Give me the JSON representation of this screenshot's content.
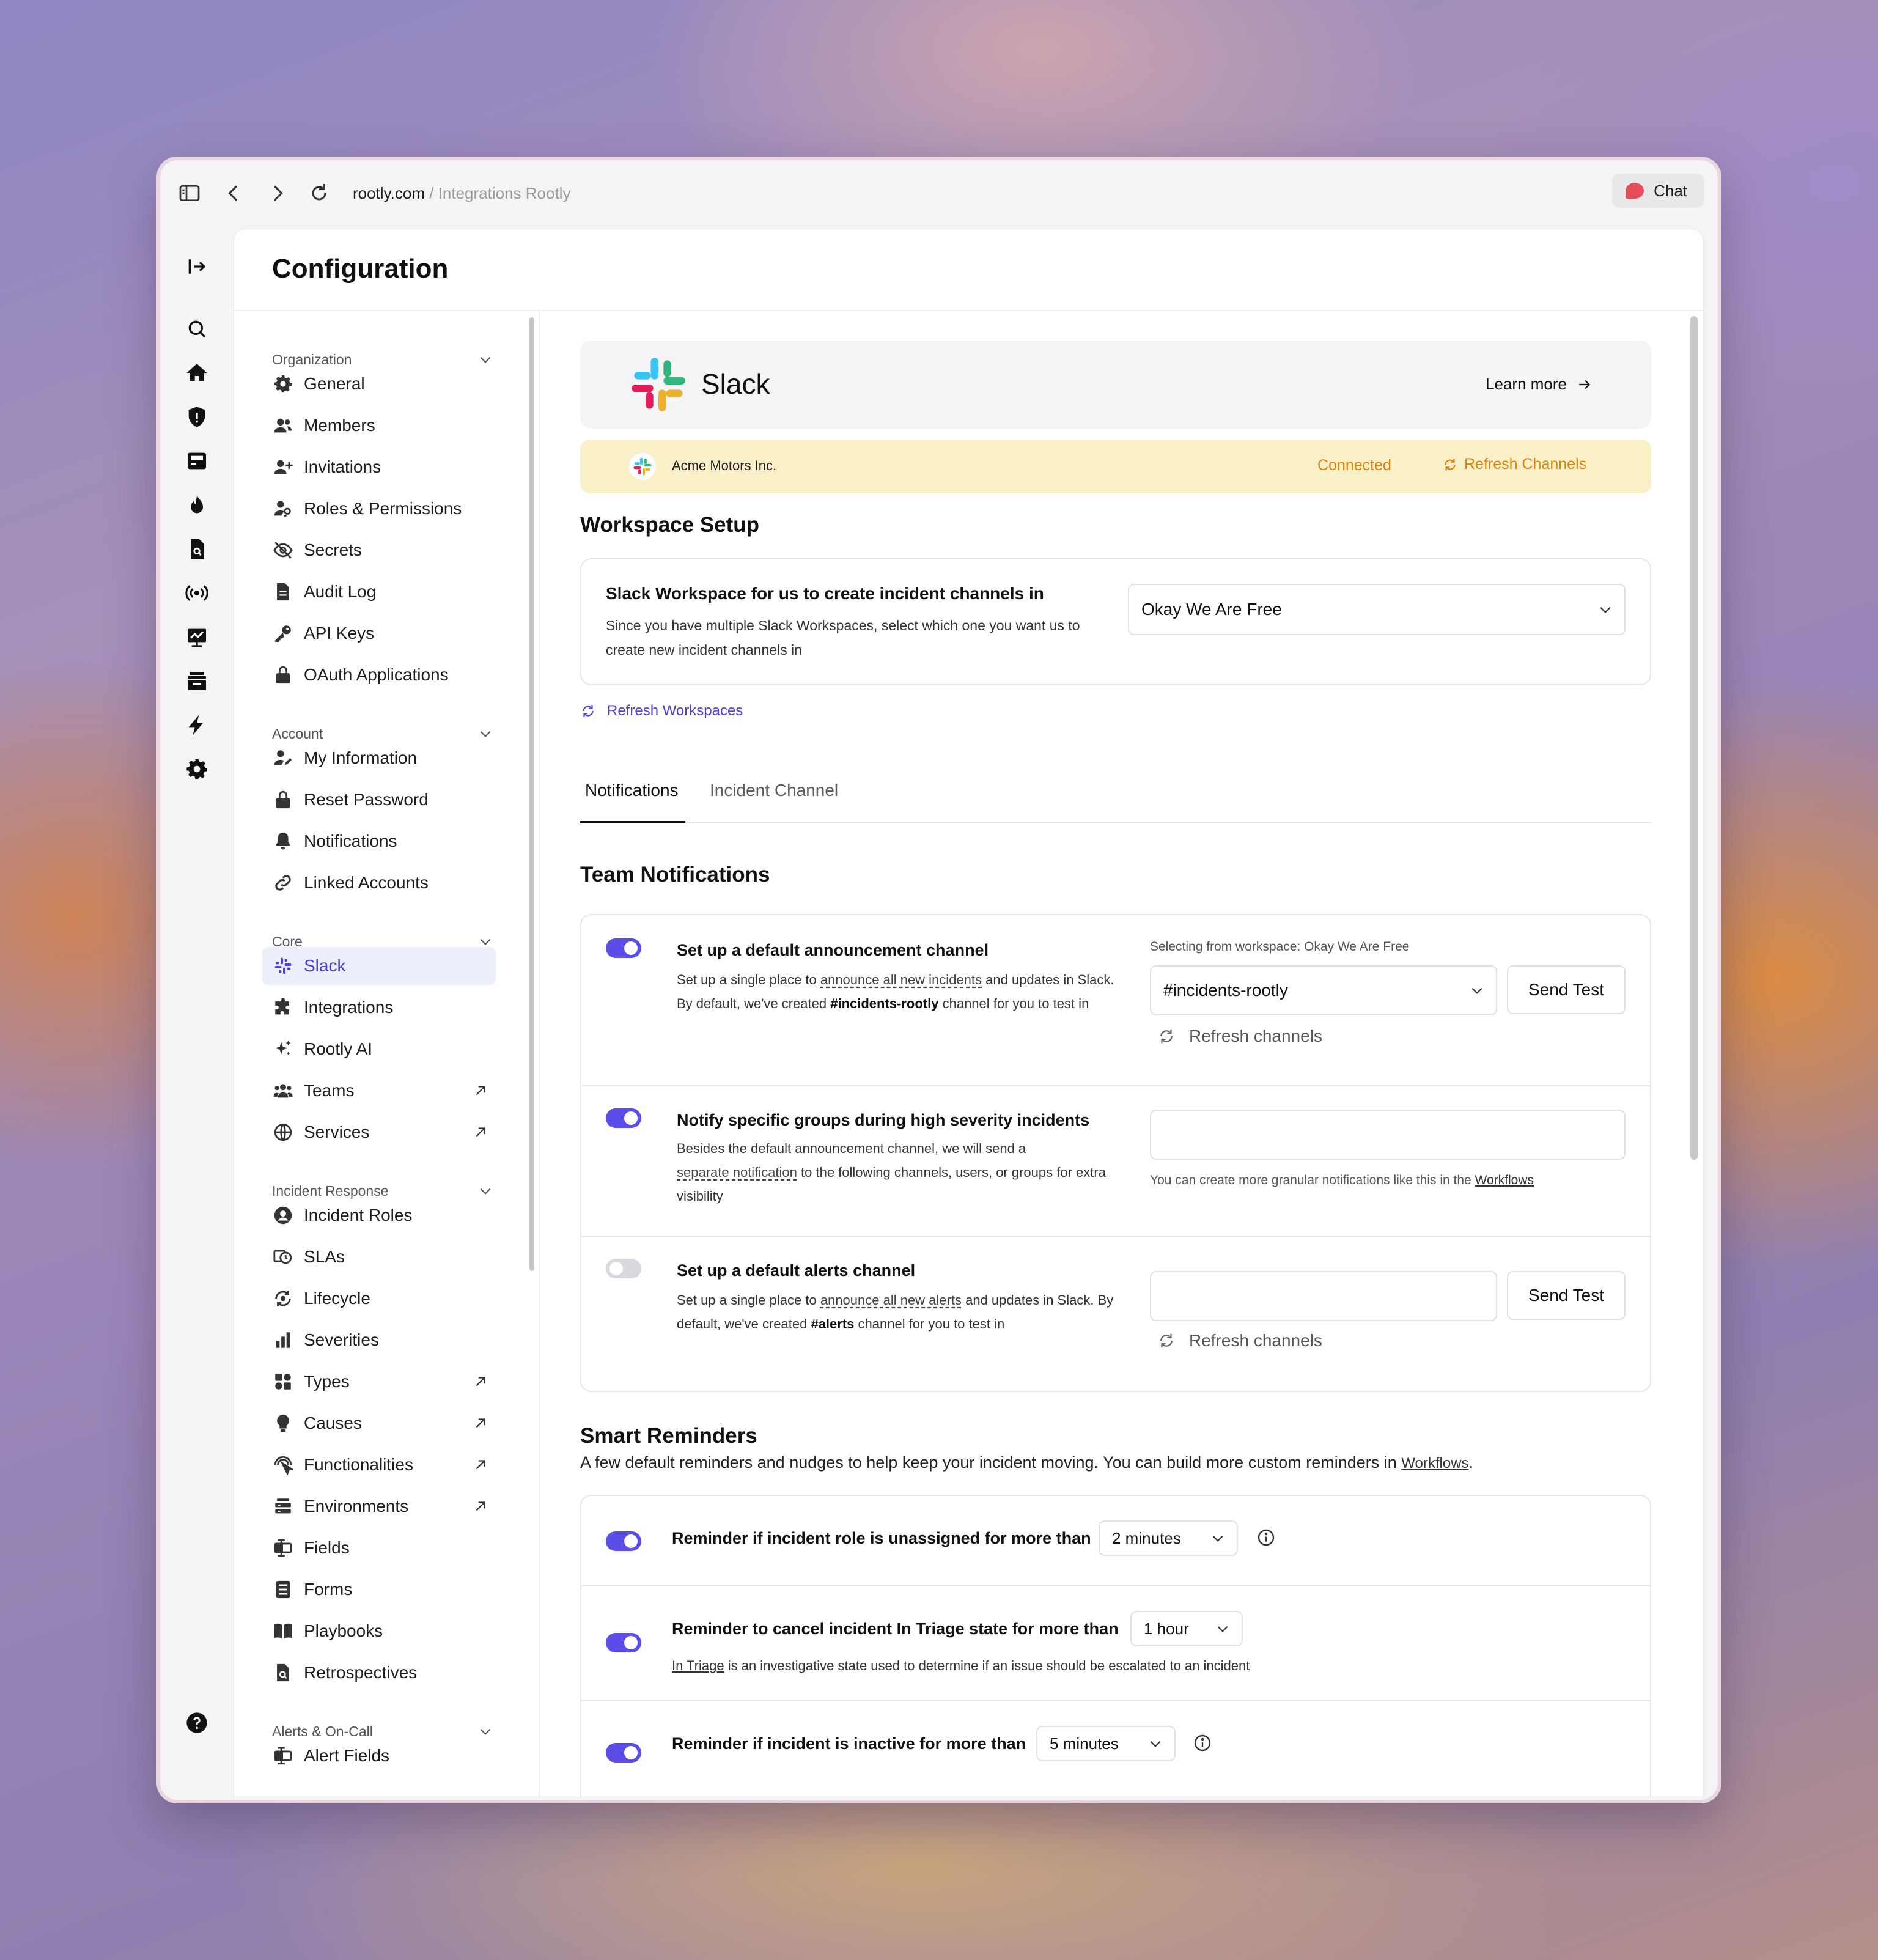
{
  "browser": {
    "url_domain": "rootly.com",
    "url_path": " / Integrations Rootly",
    "chat_label": "Chat"
  },
  "page": {
    "title": "Configuration"
  },
  "sidebar": {
    "sections": [
      {
        "label": "Organization"
      },
      {
        "label": "Account"
      },
      {
        "label": "Core"
      },
      {
        "label": "Incident Response"
      },
      {
        "label": "Alerts & On-Call"
      }
    ],
    "items": [
      {
        "label": "General",
        "icon": "gear-icon"
      },
      {
        "label": "Members",
        "icon": "users-icon"
      },
      {
        "label": "Invitations",
        "icon": "user-plus-icon"
      },
      {
        "label": "Roles & Permissions",
        "icon": "user-key-icon"
      },
      {
        "label": "Secrets",
        "icon": "eye-slash-icon"
      },
      {
        "label": "Audit Log",
        "icon": "file-icon"
      },
      {
        "label": "API Keys",
        "icon": "key-icon"
      },
      {
        "label": "OAuth Applications",
        "icon": "lock-icon"
      },
      {
        "label": "My Information",
        "icon": "user-pen-icon"
      },
      {
        "label": "Reset Password",
        "icon": "lock-icon"
      },
      {
        "label": "Notifications",
        "icon": "bell-icon"
      },
      {
        "label": "Linked Accounts",
        "icon": "link-icon"
      },
      {
        "label": "Slack",
        "icon": "slack-icon"
      },
      {
        "label": "Integrations",
        "icon": "puzzle-icon"
      },
      {
        "label": "Rootly AI",
        "icon": "sparkle-icon"
      },
      {
        "label": "Teams",
        "icon": "team-icon"
      },
      {
        "label": "Services",
        "icon": "globe-icon"
      },
      {
        "label": "Incident Roles",
        "icon": "user-circle-icon"
      },
      {
        "label": "SLAs",
        "icon": "clock-icon"
      },
      {
        "label": "Lifecycle",
        "icon": "cycle-icon"
      },
      {
        "label": "Severities",
        "icon": "bars-icon"
      },
      {
        "label": "Types",
        "icon": "shapes-icon"
      },
      {
        "label": "Causes",
        "icon": "lightbulb-icon"
      },
      {
        "label": "Functionalities",
        "icon": "pointer-icon"
      },
      {
        "label": "Environments",
        "icon": "server-icon"
      },
      {
        "label": "Fields",
        "icon": "fields-icon"
      },
      {
        "label": "Forms",
        "icon": "form-icon"
      },
      {
        "label": "Playbooks",
        "icon": "book-icon"
      },
      {
        "label": "Retrospectives",
        "icon": "doc-search-icon"
      },
      {
        "label": "Alert Fields",
        "icon": "fields-icon"
      }
    ]
  },
  "integration": {
    "name": "Slack",
    "learn_more": "Learn more",
    "workspace_name": "Acme Motors Inc.",
    "status": "Connected",
    "refresh_channels": "Refresh Channels"
  },
  "workspace_setup": {
    "heading": "Workspace Setup",
    "question": "Slack Workspace for us to create incident channels in",
    "description": "Since you have multiple Slack Workspaces, select which one you want us to create new incident channels in",
    "selected_workspace": "Okay We Are Free",
    "refresh_workspaces": "Refresh Workspaces"
  },
  "tabs": [
    {
      "label": "Notifications",
      "active": true
    },
    {
      "label": "Incident Channel",
      "active": false
    }
  ],
  "team_notifications": {
    "heading": "Team Notifications",
    "rows": [
      {
        "title": "Set up a default announcement channel",
        "desc_1": "Set up a single place to ",
        "desc_link": "announce all new incidents",
        "desc_2": " and updates in Slack.",
        "desc_3": "By default, we've created ",
        "desc_bold": "#incidents-rootly",
        "desc_4": " channel for you to test in",
        "enabled": true,
        "workspace_label": "Selecting from workspace: Okay We Are Free",
        "channel": "#incidents-rootly",
        "send_test": "Send Test",
        "refresh": "Refresh channels"
      },
      {
        "title": "Notify specific groups during high severity incidents",
        "desc_1": "Besides the default announcement channel, we will send a",
        "desc_link": "separate notification",
        "desc_2": " to the following channels, users, or groups for extra visibility",
        "enabled": true,
        "hint": "You can create more granular notifications like this in the ",
        "hint_link": "Workflows"
      },
      {
        "title": "Set up a default alerts channel",
        "desc_1": "Set up a single place to ",
        "desc_link": "announce all new alerts",
        "desc_2": " and updates in Slack. By",
        "desc_3": "default, we've created ",
        "desc_bold": "#alerts",
        "desc_4": " channel for you to test in",
        "enabled": false,
        "send_test": "Send Test",
        "refresh": "Refresh channels"
      }
    ]
  },
  "smart_reminders": {
    "heading": "Smart Reminders",
    "description": "A few default reminders and nudges to help keep your incident moving. You can build more custom reminders in ",
    "description_link": "Workflows",
    "description_end": ".",
    "rows": [
      {
        "title": "Reminder if incident role is unassigned for more than",
        "value": "2 minutes",
        "enabled": true
      },
      {
        "title": "Reminder to cancel incident In Triage state for more than",
        "value": "1 hour",
        "enabled": true,
        "note_link": "In Triage",
        "note": " is an investigative state used to determine if an issue should be escalated to an incident"
      },
      {
        "title": "Reminder if incident is inactive for more than",
        "value": "5 minutes",
        "enabled": true
      }
    ]
  },
  "colors": {
    "accent": "#5b4de8",
    "warning_bg": "#faf0c8",
    "warning_text": "#d9830f"
  }
}
